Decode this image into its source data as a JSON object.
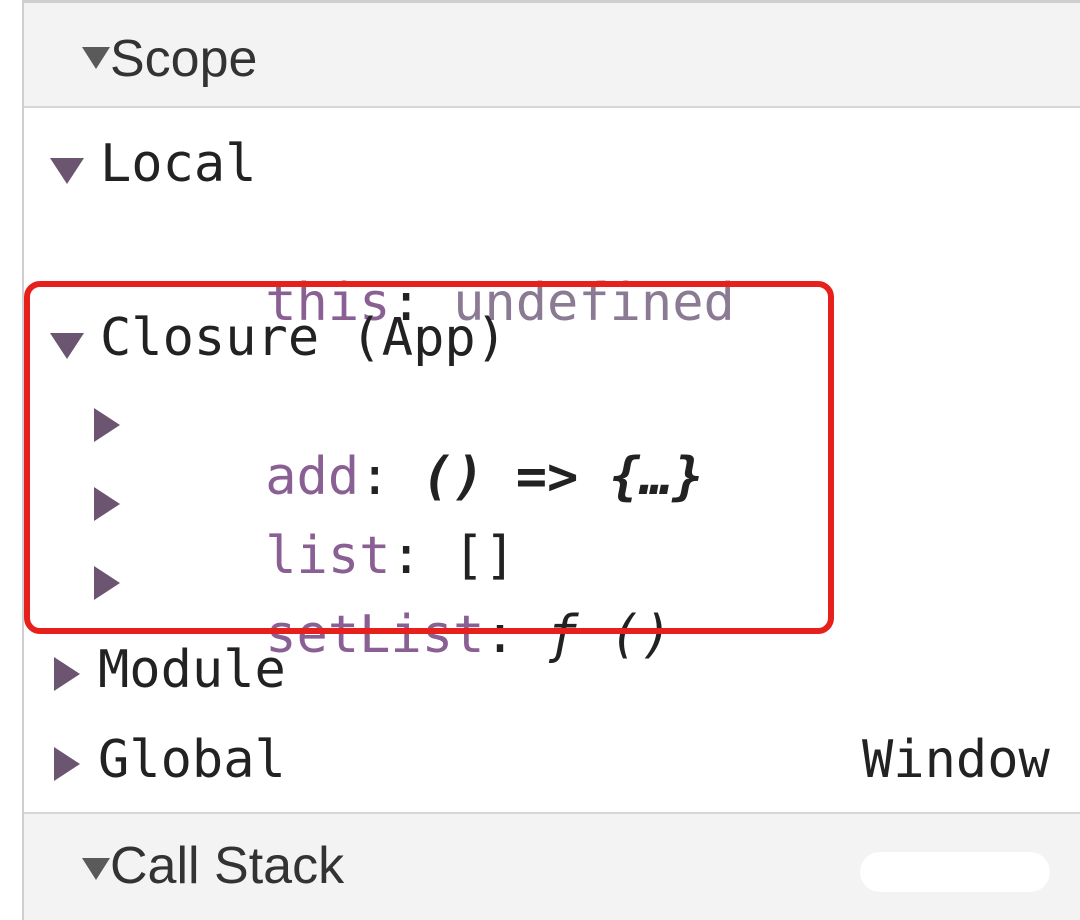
{
  "scope_header": {
    "label": "Scope"
  },
  "local": {
    "label": "Local",
    "this_key": "this",
    "this_value": "undefined"
  },
  "closure": {
    "label": "Closure (App)",
    "items": [
      {
        "key": "add",
        "value": "() => {…}"
      },
      {
        "key": "list",
        "value": "[]"
      },
      {
        "key": "setList",
        "value": "ƒ ()"
      }
    ]
  },
  "module": {
    "label": "Module"
  },
  "global": {
    "label": "Global",
    "value": "Window"
  },
  "call_stack_header": {
    "label": "Call Stack"
  },
  "colors": {
    "highlight_border": "#e8201c",
    "property_name": "#8a5f93",
    "header_bg": "#f3f3f3"
  }
}
